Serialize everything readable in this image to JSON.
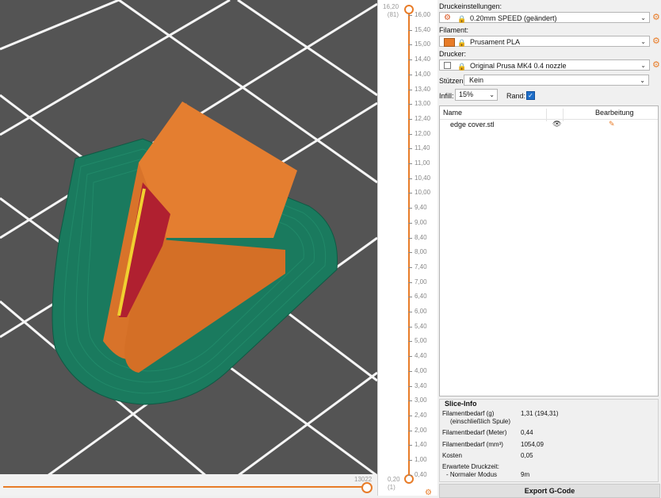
{
  "viewport": {
    "colors": {
      "background": "#545454",
      "grid": "#ffffff",
      "skirt": "#1a7a5e",
      "wall": "#e07a2c",
      "infill": "#b02030",
      "highlight": "#f0d030"
    },
    "horizontal_ticks_label": "13022"
  },
  "layer_slider": {
    "top_value": "16,20",
    "top_layer": "(81)",
    "bottom_value": "0,20",
    "bottom_layer": "(1)",
    "ticks": [
      "16,00",
      "15,40",
      "15,00",
      "14,40",
      "14,00",
      "13,40",
      "13,00",
      "12,40",
      "12,00",
      "11,40",
      "11,00",
      "10,40",
      "10,00",
      "9,40",
      "9,00",
      "8,40",
      "8,00",
      "7,40",
      "7,00",
      "6,40",
      "6,00",
      "5,40",
      "5,00",
      "4,40",
      "4,00",
      "3,40",
      "3,00",
      "2,40",
      "2,00",
      "1,40",
      "1,00",
      "0,40"
    ]
  },
  "panel": {
    "print_settings": {
      "label": "Druckeinstellungen:",
      "value": "0.20mm SPEED (geändert)",
      "icon": "gear-icon"
    },
    "filament": {
      "label": "Filament:",
      "value": "Prusament PLA",
      "color": "#e87c28"
    },
    "printer": {
      "label": "Drucker:",
      "value": "Original Prusa MK4 0.4 nozzle",
      "icon": "printer-icon"
    },
    "supports": {
      "label": "Stützen:",
      "value": "Kein"
    },
    "infill": {
      "label": "Infill:",
      "value": "15%"
    },
    "brim": {
      "label": "Rand:",
      "checked": true
    },
    "object_list": {
      "columns": [
        "Name",
        "Bearbeitung"
      ],
      "rows": [
        {
          "name": "edge cover.stl",
          "visibility_icon": "eye-icon",
          "edit_icon": "edit-icon"
        }
      ]
    },
    "slice_info": {
      "title": "Slice-Info",
      "filament_g_label": "Filamentbedarf (g)",
      "filament_g_sub": "(einschließlich Spule)",
      "filament_g_value": "1,31 (194,31)",
      "filament_m_label": "Filamentbedarf (Meter)",
      "filament_m_value": "0,44",
      "filament_mm3_label": "Filamentbedarf (mm³)",
      "filament_mm3_value": "1054,09",
      "cost_label": "Kosten",
      "cost_value": "0,05",
      "expected_time_label": "Erwartete Druckzeit:",
      "normal_mode_label": "- Normaler Modus",
      "normal_mode_value": "9m"
    },
    "export_button": "Export G-Code"
  }
}
